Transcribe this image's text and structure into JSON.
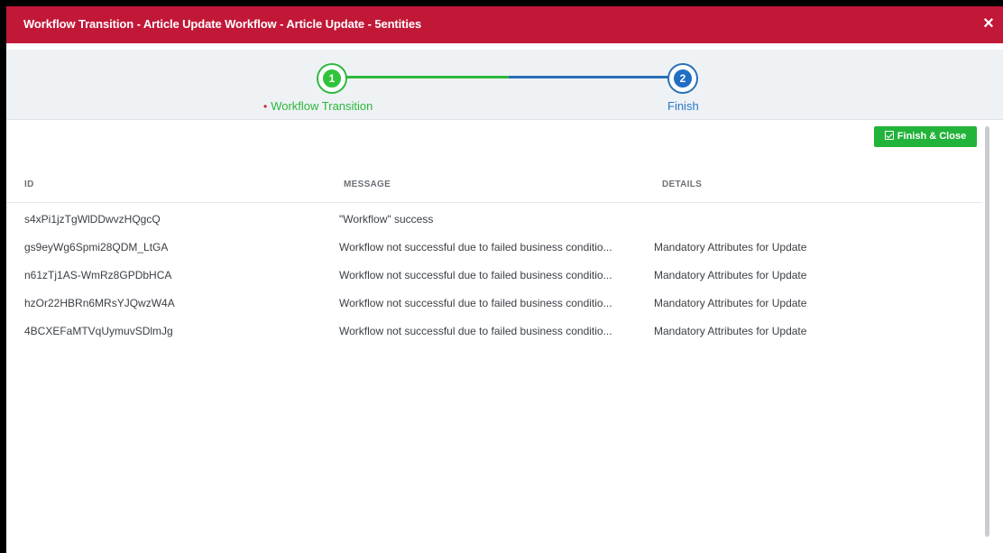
{
  "dialog": {
    "title": "Workflow Transition - Article Update Workflow - Article Update - 5entities",
    "close_label": "×"
  },
  "stepper": {
    "steps": [
      {
        "number": "1",
        "label": "Workflow Transition",
        "color": "#2cb83a"
      },
      {
        "number": "2",
        "label": "Finish",
        "color": "#2a6fb8"
      }
    ],
    "error_dot": "•"
  },
  "toolbar": {
    "finish_close_label": "Finish & Close"
  },
  "table": {
    "columns": [
      "ID",
      "MESSAGE",
      "DETAILS"
    ],
    "rows": [
      {
        "id": "s4xPi1jzTgWlDDwvzHQgcQ",
        "message": "\"Workflow\" success",
        "details": ""
      },
      {
        "id": "gs9eyWg6Spmi28QDM_LtGA",
        "message": "Workflow not successful due to failed business conditio...",
        "details": "Mandatory Attributes for Update"
      },
      {
        "id": "n61zTj1AS-WmRz8GPDbHCA",
        "message": "Workflow not successful due to failed business conditio...",
        "details": "Mandatory Attributes for Update"
      },
      {
        "id": "hzOr22HBRn6MRsYJQwzW4A",
        "message": "Workflow not successful due to failed business conditio...",
        "details": "Mandatory Attributes for Update"
      },
      {
        "id": "4BCXEFaMTVqUymuvSDlmJg",
        "message": "Workflow not successful due to failed business conditio...",
        "details": "Mandatory Attributes for Update"
      }
    ]
  },
  "colors": {
    "titlebar": "#c21838",
    "success": "#22b33a",
    "step_active": "#2a6fb8"
  }
}
